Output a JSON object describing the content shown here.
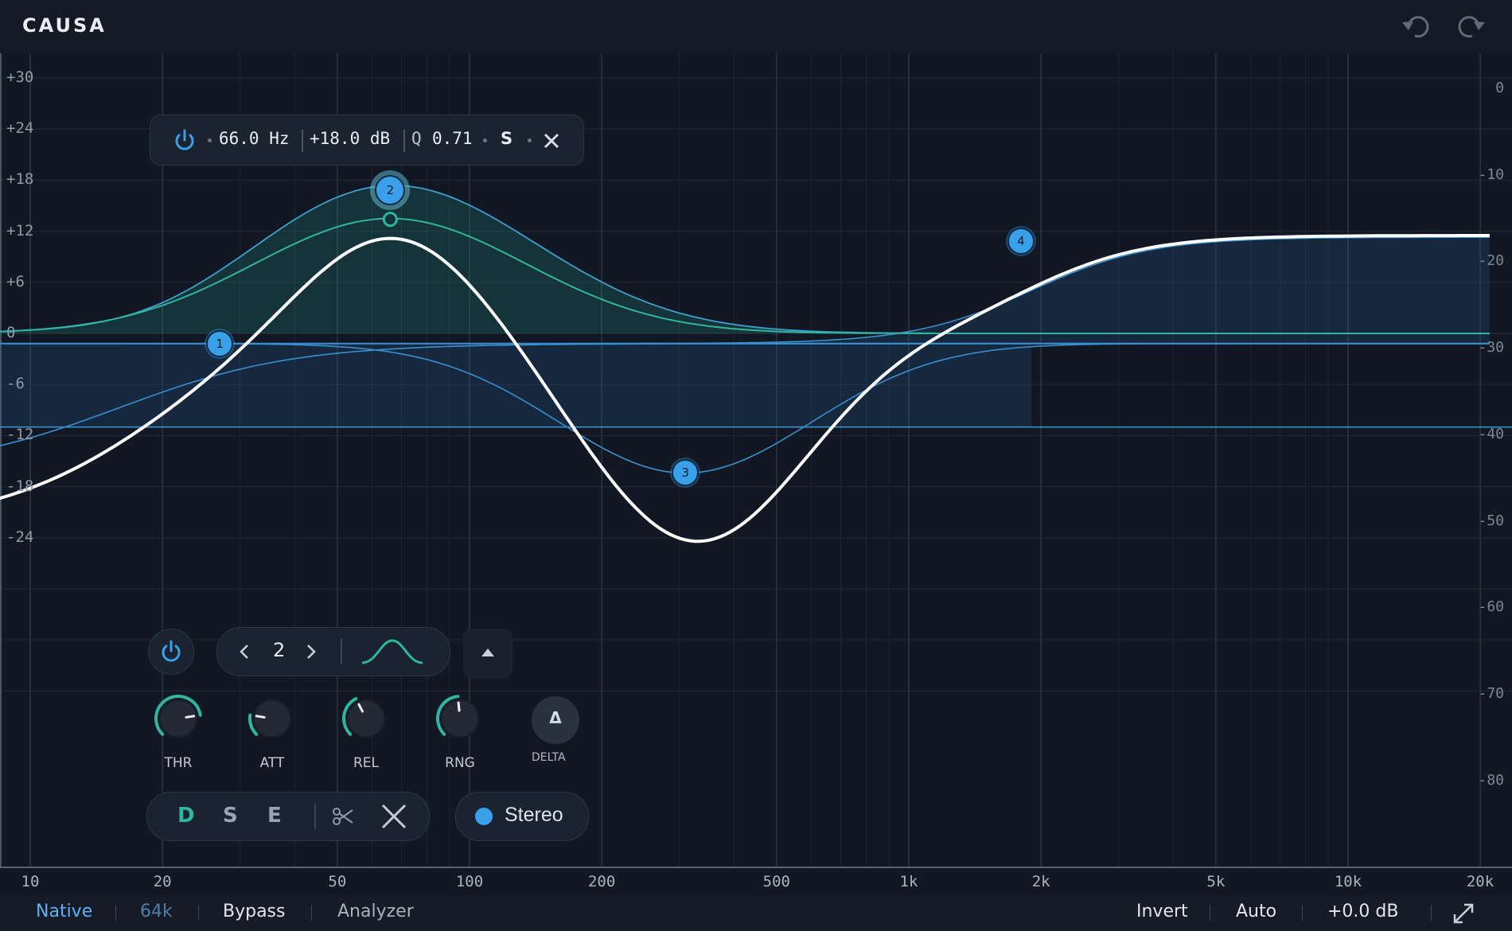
{
  "app": {
    "title": "CAUSA"
  },
  "toolbar": {
    "undo_icon": "undo-icon",
    "redo_icon": "redo-icon"
  },
  "axes": {
    "db_left": [
      "+30",
      "+24",
      "+18",
      "+12",
      "+6",
      "0",
      "-6",
      "-12",
      "-18",
      "-24"
    ],
    "db_right": [
      "0",
      "-10",
      "-20",
      "-30",
      "-40",
      "-50",
      "-60",
      "-70",
      "-80"
    ],
    "freq": [
      "10",
      "20",
      "50",
      "100",
      "200",
      "500",
      "1k",
      "2k",
      "5k",
      "10k",
      "20k"
    ]
  },
  "nodes": [
    {
      "id": "1",
      "freq_hz": 27,
      "gain_db": -1.2
    },
    {
      "id": "2",
      "freq_hz": 66,
      "gain_db": 16.8,
      "selected": true
    },
    {
      "id": "3",
      "freq_hz": 310,
      "gain_db": -16.4
    },
    {
      "id": "4",
      "freq_hz": 1800,
      "gain_db": 10.8
    }
  ],
  "band_tooltip": {
    "freq": "66.0 Hz",
    "gain": "+18.0 dB",
    "q_label": "Q",
    "q_value": "0.71",
    "solo": "S"
  },
  "band_panel": {
    "band_number": "2",
    "knobs": [
      {
        "label": "THR",
        "value": 0.8
      },
      {
        "label": "ATT",
        "value": 0.2
      },
      {
        "label": "REL",
        "value": 0.4
      },
      {
        "label": "RNG",
        "value": 0.48
      }
    ],
    "delta_symbol": "Δ",
    "delta_label": "DELTA",
    "modes": {
      "d": "D",
      "s": "S",
      "e": "E"
    },
    "stereo_label": "Stereo"
  },
  "bottom_bar": {
    "native": "Native",
    "rate": "64k",
    "bypass": "Bypass",
    "analyzer": "Analyzer",
    "invert": "Invert",
    "auto": "Auto",
    "output_gain": "+0.0 dB"
  },
  "colors": {
    "accent_blue": "#3aa0ea",
    "accent_teal": "#2fb5a0",
    "background": "#111823",
    "curve_white": "#ffffff"
  }
}
